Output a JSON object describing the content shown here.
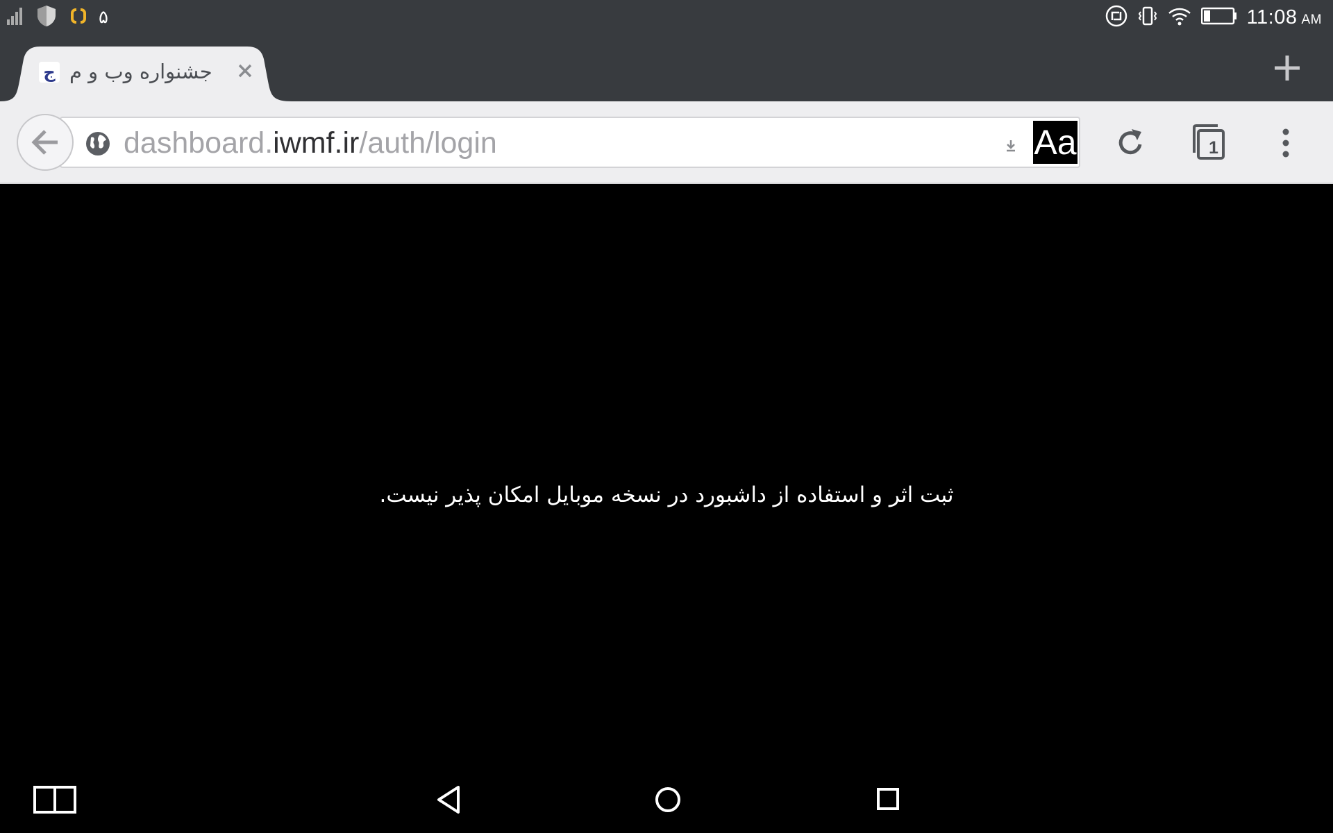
{
  "status_bar": {
    "left_icons": [
      "signal-icon",
      "shield-icon",
      "sync-app-icon"
    ],
    "left_digit": "۵",
    "right_icons": [
      "nfc-icon",
      "vibrate-icon",
      "wifi-icon",
      "battery-icon"
    ],
    "time": "11:08",
    "ampm": "AM",
    "accent_color": "#f0b429"
  },
  "tab": {
    "favicon_letter": "ج",
    "title": "جشنواره وب و م",
    "close_icon": "close-icon"
  },
  "toolbar": {
    "url_prefix": "dashboard.",
    "url_host": "iwmf.ir",
    "url_path": "/auth/login",
    "reader_label": "Aa",
    "tab_count": "1"
  },
  "content": {
    "message": "ثبت اثر و استفاده از داشبورد در نسخه موبایل امکان پذیر نیست."
  },
  "colors": {
    "chrome_dark": "#383b3f",
    "toolbar_bg": "#eeeef0",
    "page_bg": "#000000"
  }
}
